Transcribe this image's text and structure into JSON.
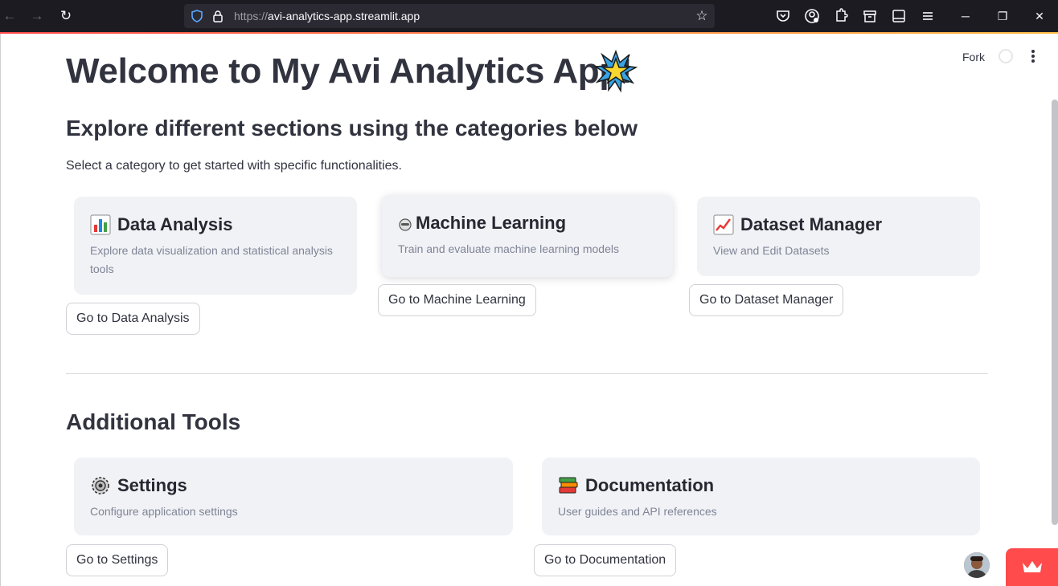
{
  "browser": {
    "url_protocol": "https://",
    "url_host": "avi-analytics-app.streamlit.app"
  },
  "app": {
    "toolbar": {
      "fork_label": "Fork"
    },
    "title": "Welcome to My Avi Analytics App!",
    "subtitle": "Explore different sections using the categories below",
    "intro": "Select a category to get started with specific functionalities.",
    "categories": [
      {
        "icon": "bar-chart-icon",
        "title": "Data Analysis",
        "description": "Explore data visualization and statistical analysis tools",
        "button": "Go to Data Analysis"
      },
      {
        "icon": "robot-icon",
        "title": "Machine Learning",
        "description": "Train and evaluate machine learning models",
        "button": "Go to Machine Learning"
      },
      {
        "icon": "trending-chart-icon",
        "title": "Dataset Manager",
        "description": "View and Edit Datasets",
        "button": "Go to Dataset Manager"
      }
    ],
    "additional_tools_heading": "Additional Tools",
    "tools": [
      {
        "icon": "gear-icon",
        "title": "Settings",
        "description": "Configure application settings",
        "button": "Go to Settings"
      },
      {
        "icon": "books-icon",
        "title": "Documentation",
        "description": "User guides and API references",
        "button": "Go to Documentation"
      }
    ]
  },
  "colors": {
    "accent": "#ff4b4b",
    "text": "#31333f",
    "card_bg": "#f0f2f6",
    "muted": "#808495"
  }
}
